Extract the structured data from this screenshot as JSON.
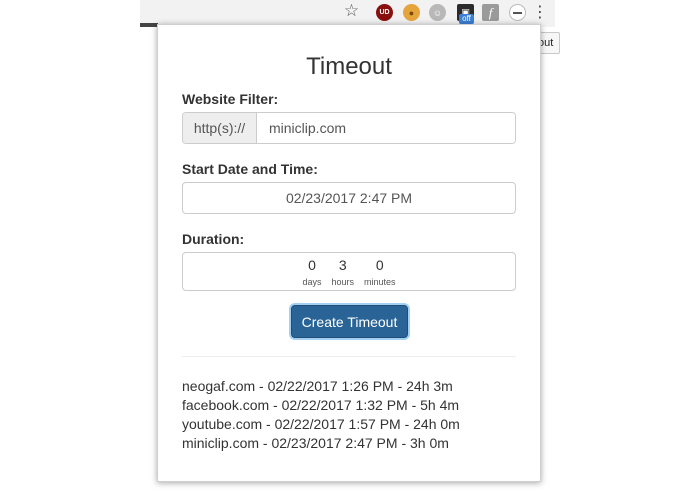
{
  "toolbar": {
    "icons": [
      "star-icon",
      "ublock-icon",
      "cookie-icon",
      "ghostery-icon",
      "camera-icon",
      "font-icon",
      "timeout-extension-icon",
      "menu-dots-icon"
    ],
    "ublock_label": "UD",
    "camera_badge": "off",
    "font_glyph": "f"
  },
  "tooltip": {
    "text": "Timeout"
  },
  "popup": {
    "title": "Timeout",
    "website_filter": {
      "label": "Website Filter:",
      "prefix": "http(s)://",
      "value": "miniclip.com"
    },
    "start": {
      "label": "Start Date and Time:",
      "value": "02/23/2017 2:47 PM"
    },
    "duration": {
      "label": "Duration:",
      "fields": [
        {
          "value": "0",
          "unit": "days"
        },
        {
          "value": "3",
          "unit": "hours"
        },
        {
          "value": "0",
          "unit": "minutes"
        }
      ]
    },
    "create_button": "Create Timeout",
    "timeouts": [
      "neogaf.com - 02/22/2017 1:26 PM - 24h 3m",
      "facebook.com - 02/22/2017 1:32 PM - 5h 4m",
      "youtube.com - 02/22/2017 1:57 PM - 24h 0m",
      "miniclip.com - 02/23/2017 2:47 PM - 3h 0m"
    ]
  },
  "colors": {
    "button_bg": "#2a6496",
    "addon_bg": "#eeeeee",
    "text": "#333333"
  }
}
